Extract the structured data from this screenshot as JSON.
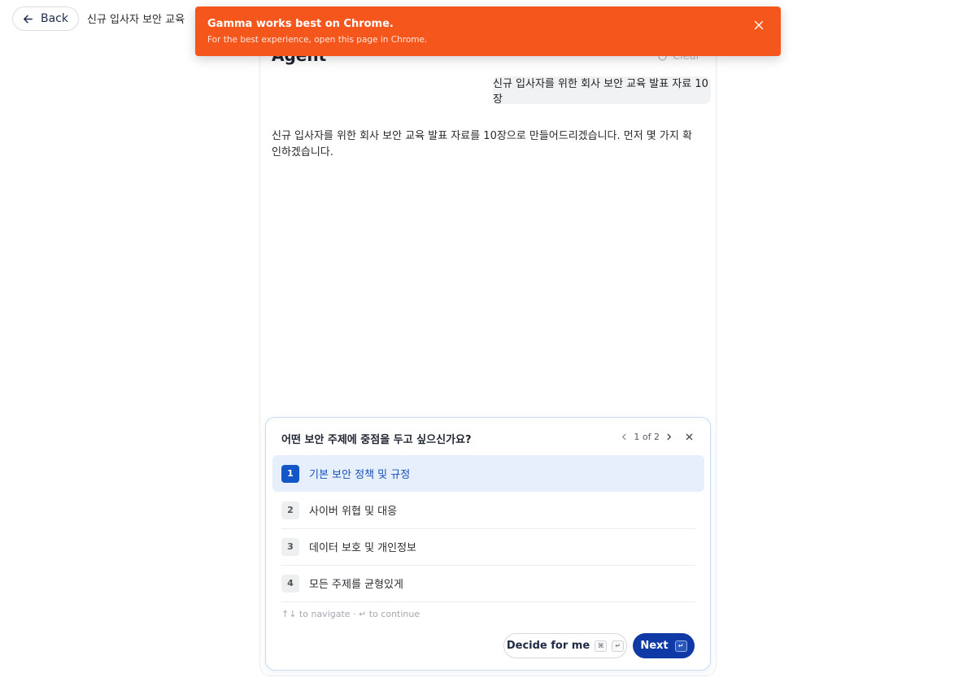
{
  "header": {
    "back_label": "Back",
    "doc_title": "신규 입사자 보안 교육"
  },
  "toast": {
    "title": "Gamma works best on Chrome.",
    "body": "For the best experience, open this page in Chrome."
  },
  "agent": {
    "title": "Agent",
    "clear_label": "Clear",
    "user_message": "신규 입사자를 위한 회사 보안 교육 발표 자료 10장",
    "agent_message": "신규 입사자를 위한 회사 보안 교육 발표 자료를 10장으로 만들어드리겠습니다. 먼저 몇 가지 확인하겠습니다."
  },
  "question": {
    "title": "어떤 보안 주제에 중점을 두고 싶으신가요?",
    "pager": "1 of 2",
    "options": [
      {
        "num": "1",
        "label": "기본 보안 정책 및 규정",
        "selected": true
      },
      {
        "num": "2",
        "label": "사이버 위협 및 대응"
      },
      {
        "num": "3",
        "label": "데이터 보호 및 개인정보"
      },
      {
        "num": "4",
        "label": "모든 주제를 균형있게"
      }
    ],
    "hint": "↑↓ to navigate · ↵ to continue",
    "decide_label": "Decide for me",
    "decide_kbd_1": "⌘",
    "decide_kbd_2": "↵",
    "next_label": "Next",
    "next_kbd": "↵"
  },
  "colors": {
    "toast_bg": "#f4561c",
    "primary": "#0f3aa6",
    "selected_bg": "#e6effb",
    "selected_text": "#1651b8"
  }
}
